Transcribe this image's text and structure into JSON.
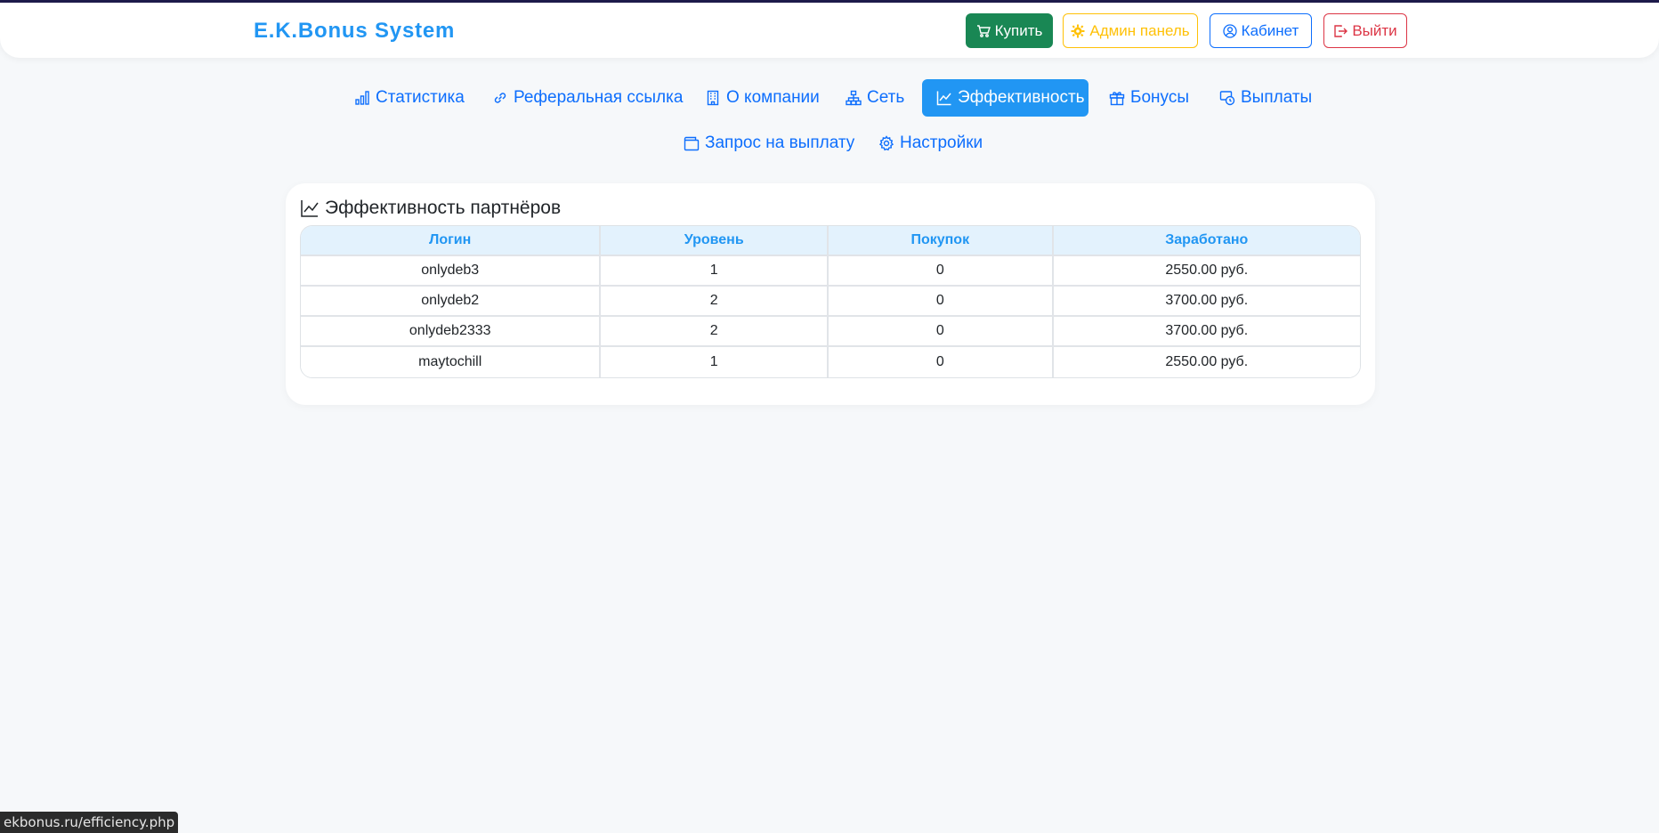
{
  "header": {
    "brand": "E.K.Bonus System",
    "buttons": {
      "buy": "Купить",
      "admin": "Админ панель",
      "cabinet": "Кабинет",
      "logout": "Выйти"
    }
  },
  "nav": {
    "items": [
      {
        "label": "Статистика",
        "icon": "bar-chart-icon"
      },
      {
        "label": "Реферальная ссылка",
        "icon": "link-icon"
      },
      {
        "label": "О компании",
        "icon": "building-icon"
      },
      {
        "label": "Сеть",
        "icon": "network-icon"
      },
      {
        "label": "Эффективность",
        "icon": "line-chart-icon",
        "active": true
      },
      {
        "label": "Бонусы",
        "icon": "gift-icon"
      },
      {
        "label": "Выплаты",
        "icon": "cash-icon"
      },
      {
        "label": "Запрос на выплату",
        "icon": "wallet-icon"
      },
      {
        "label": "Настройки",
        "icon": "gear-icon"
      }
    ]
  },
  "card": {
    "title": "Эффективность партнёров",
    "table": {
      "headers": [
        "Логин",
        "Уровень",
        "Покупок",
        "Заработано"
      ],
      "rows": [
        [
          "onlydeb3",
          "1",
          "0",
          "2550.00 руб."
        ],
        [
          "onlydeb2",
          "2",
          "0",
          "3700.00 руб."
        ],
        [
          "onlydeb2333",
          "2",
          "0",
          "3700.00 руб."
        ],
        [
          "maytochill",
          "1",
          "0",
          "2550.00 руб."
        ]
      ]
    }
  },
  "statusbar": {
    "url": "ekbonus.ru/efficiency.php"
  },
  "colors": {
    "accent": "#2196f3",
    "buy": "#198754",
    "admin": "#ffc107",
    "cabinet": "#0d6efd",
    "logout": "#dc3545"
  }
}
